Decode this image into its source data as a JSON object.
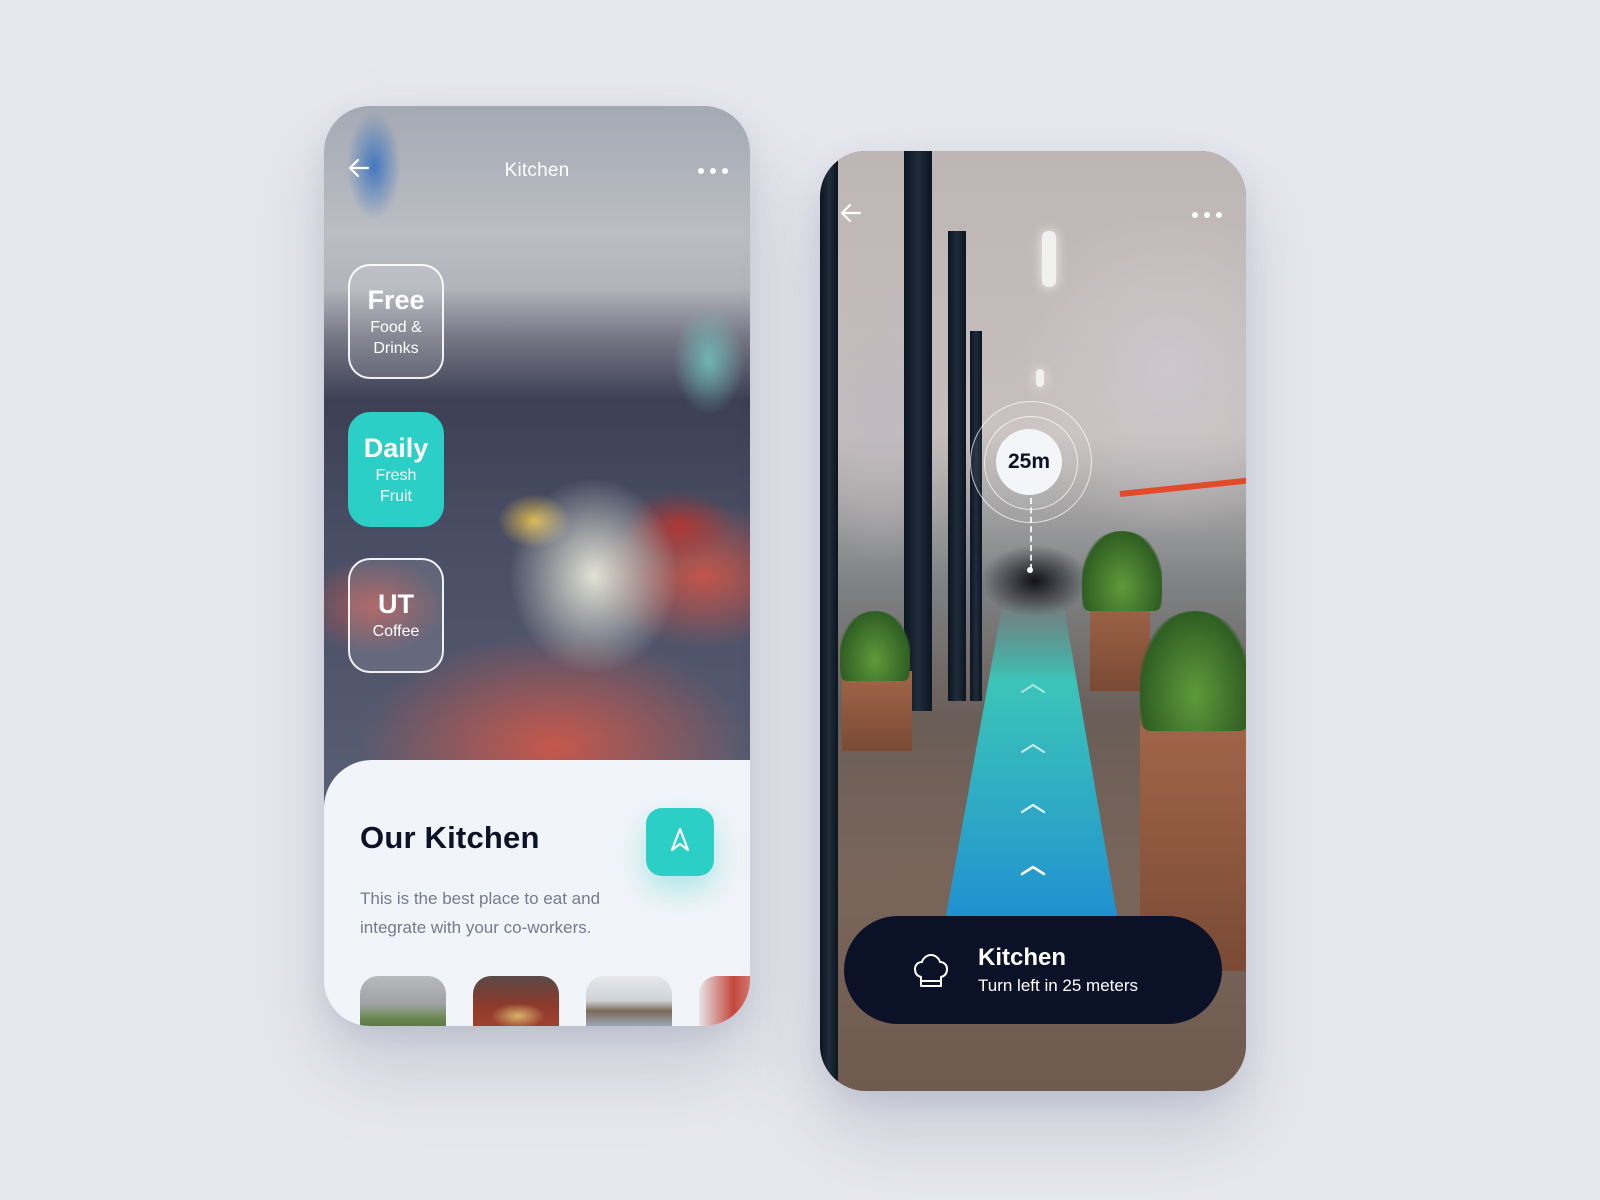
{
  "phone_detail": {
    "header": {
      "back_icon": "arrow-left-icon",
      "title": "Kitchen",
      "more_icon": "more-horizontal-icon"
    },
    "chips": [
      {
        "title": "Free",
        "subtitle_line1": "Food &",
        "subtitle_line2": "Drinks",
        "active": false
      },
      {
        "title": "Daily",
        "subtitle_line1": "Fresh",
        "subtitle_line2": "Fruit",
        "active": true
      },
      {
        "title": "UT",
        "subtitle_line1": "Coffee",
        "subtitle_line2": "",
        "active": false
      }
    ],
    "card": {
      "title": "Our Kitchen",
      "navigate_icon": "navigation-arrow-icon",
      "description": "This is the best place to eat and integrate with your co-workers.",
      "thumbnails": [
        "cake-photo",
        "food-table-photo",
        "kitchen-room-photo",
        "kitchen-detail-photo"
      ]
    }
  },
  "phone_ar": {
    "header": {
      "back_icon": "arrow-left-icon",
      "more_icon": "more-horizontal-icon"
    },
    "marker": {
      "distance": "25m"
    },
    "path_icon": "chevron-up-icon",
    "banner": {
      "icon": "chef-hat-icon",
      "title": "Kitchen",
      "subtitle": "Turn left in 25 meters"
    }
  },
  "colors": {
    "accent": "#2ccfc6",
    "dark": "#0b1126",
    "background": "#e7e8ef",
    "card_bg": "#f1f4f9",
    "text_primary": "#0d1227",
    "text_secondary": "#767b8c"
  }
}
